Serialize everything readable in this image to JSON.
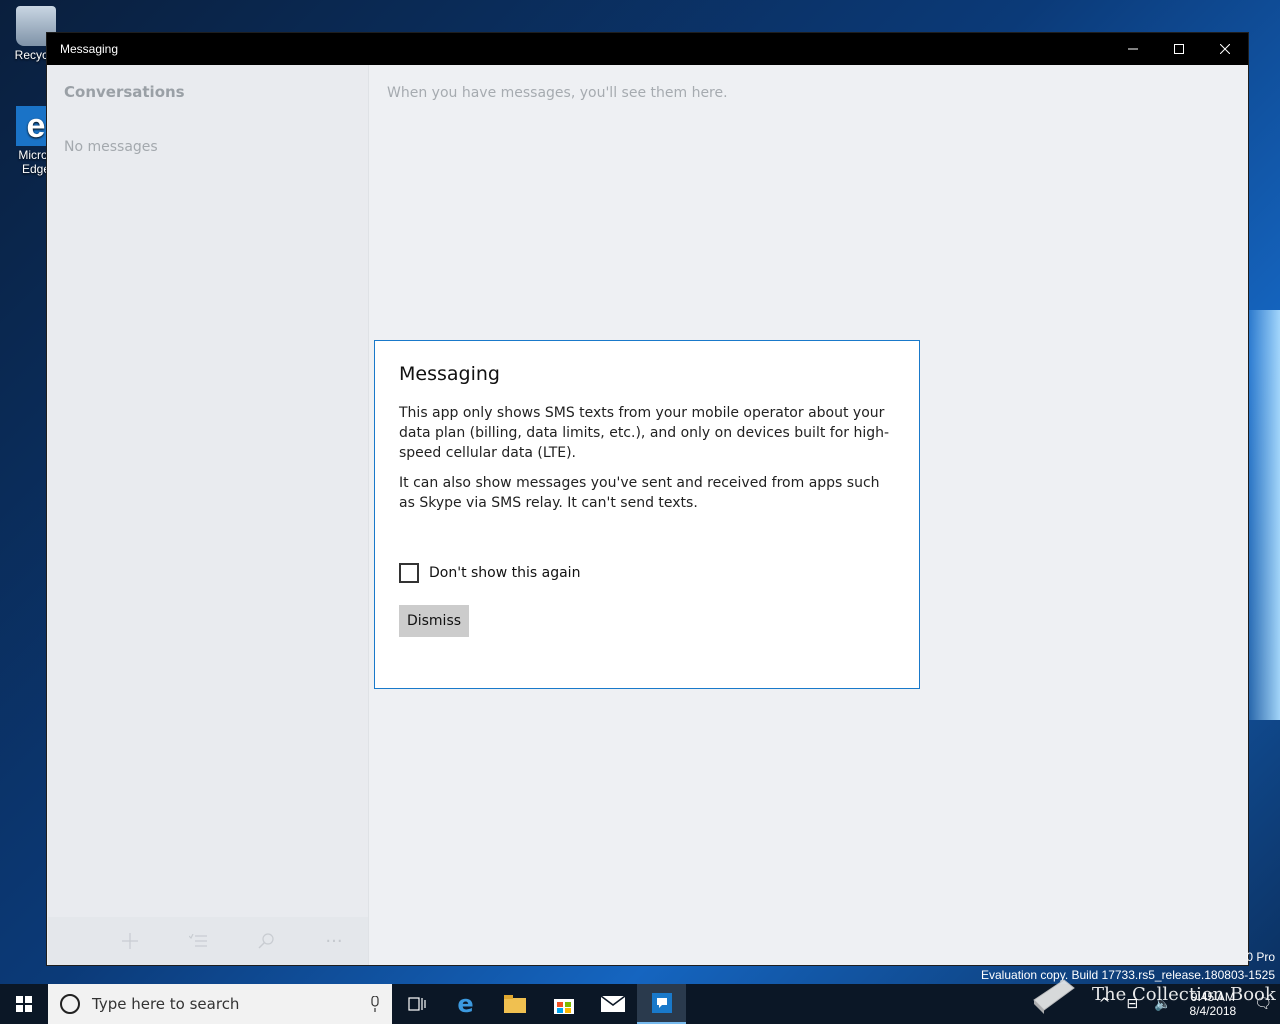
{
  "desktop": {
    "icons": [
      {
        "label": "Recycle"
      },
      {
        "label": "Micros Edge"
      }
    ]
  },
  "window": {
    "title": "Messaging",
    "controls": {
      "minimize": "minimize-icon",
      "maximize": "maximize-icon",
      "close": "close-icon"
    }
  },
  "sidebar": {
    "header": "Conversations",
    "empty_text": "No messages",
    "toolbar": [
      "add-icon",
      "select-icon",
      "search-icon",
      "more-icon"
    ],
    "more_label": "···"
  },
  "main": {
    "placeholder": "When you have messages, you'll see them here."
  },
  "dialog": {
    "title": "Messaging",
    "paragraph1": "This app only shows SMS texts from your mobile operator about your data plan (billing, data limits, etc.), and only on devices built for high-speed cellular data (LTE).",
    "paragraph2": "It can also show messages you've sent and received from apps such as Skype via SMS relay. It can't send texts.",
    "checkbox_label": "Don't show this again",
    "checkbox_checked": false,
    "button_label": "Dismiss"
  },
  "watermark": {
    "line1": "0 Pro",
    "line2": "Evaluation copy. Build 17733.rs5_release.180803-1525"
  },
  "taskbar": {
    "search_placeholder": "Type here to search",
    "apps": [
      "task-view-icon",
      "edge-icon",
      "file-explorer-icon",
      "store-icon",
      "mail-icon",
      "messaging-icon"
    ],
    "time": "9:45 AM",
    "date": "8/4/2018"
  },
  "overlay_logo": {
    "text": "The Collection Book"
  },
  "colors": {
    "accent": "#1979ca",
    "titlebar": "#000000",
    "taskbar": "#0b1726"
  }
}
